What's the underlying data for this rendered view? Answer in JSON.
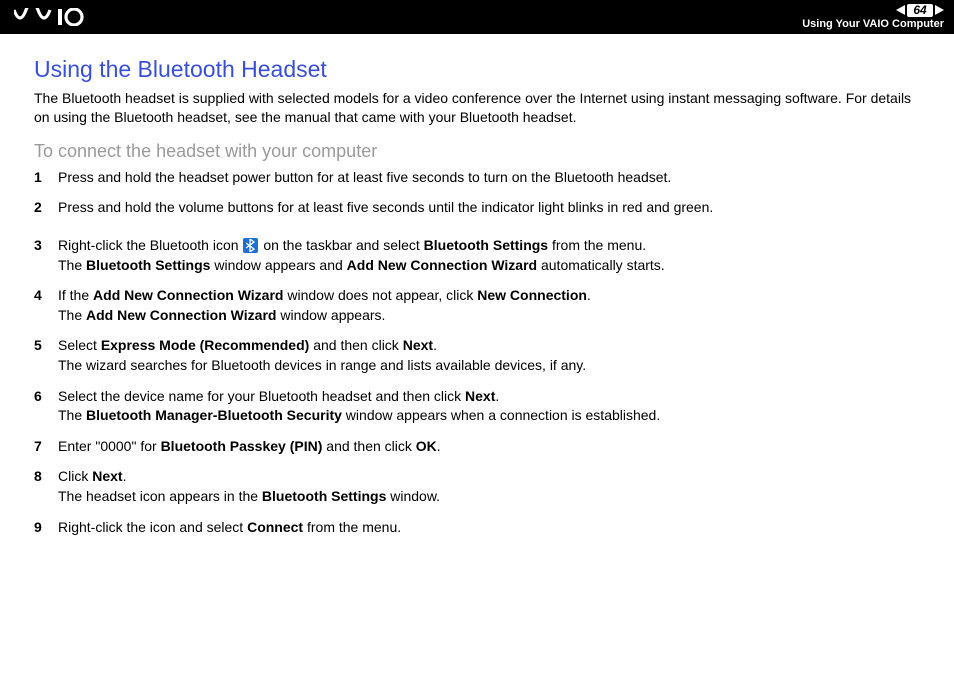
{
  "header": {
    "page_number": "64",
    "breadcrumb": "Using Your VAIO Computer"
  },
  "title": "Using the Bluetooth Headset",
  "intro": "The Bluetooth headset is supplied with selected models for a video conference over the Internet using instant messaging software. For details on using the Bluetooth headset, see the manual that came with your Bluetooth headset.",
  "subhead": "To connect the headset with your computer",
  "steps": {
    "s1": "Press and hold the headset power button for at least five seconds to turn on the Bluetooth headset.",
    "s2": "Press and hold the volume buttons for at least five seconds until the indicator light blinks in red and green.",
    "s3a": "Right-click the Bluetooth icon ",
    "s3b": " on the taskbar and select ",
    "s3c": "Bluetooth Settings",
    "s3d": " from the menu.",
    "s3e": "The ",
    "s3f": "Bluetooth Settings",
    "s3g": " window appears and ",
    "s3h": "Add New Connection Wizard",
    "s3i": " automatically starts.",
    "s4a": "If the ",
    "s4b": "Add New Connection Wizard",
    "s4c": " window does not appear, click ",
    "s4d": "New Connection",
    "s4e": ".",
    "s4f": "The ",
    "s4g": "Add New Connection Wizard",
    "s4h": " window appears.",
    "s5a": "Select ",
    "s5b": "Express Mode (Recommended)",
    "s5c": " and then click ",
    "s5d": "Next",
    "s5e": ".",
    "s5f": "The wizard searches for Bluetooth devices in range and lists available devices, if any.",
    "s6a": "Select the device name for your Bluetooth headset and then click ",
    "s6b": "Next",
    "s6c": ".",
    "s6d": "The ",
    "s6e": "Bluetooth Manager-Bluetooth Security",
    "s6f": " window appears when a connection is established.",
    "s7a": "Enter \"0000\" for ",
    "s7b": "Bluetooth Passkey (PIN)",
    "s7c": " and then click ",
    "s7d": "OK",
    "s7e": ".",
    "s8a": "Click ",
    "s8b": "Next",
    "s8c": ".",
    "s8d": "The headset icon appears in the ",
    "s8e": "Bluetooth Settings",
    "s8f": " window.",
    "s9a": "Right-click the icon and select ",
    "s9b": "Connect",
    "s9c": " from the menu."
  },
  "nums": {
    "n1": "1",
    "n2": "2",
    "n3": "3",
    "n4": "4",
    "n5": "5",
    "n6": "6",
    "n7": "7",
    "n8": "8",
    "n9": "9"
  }
}
